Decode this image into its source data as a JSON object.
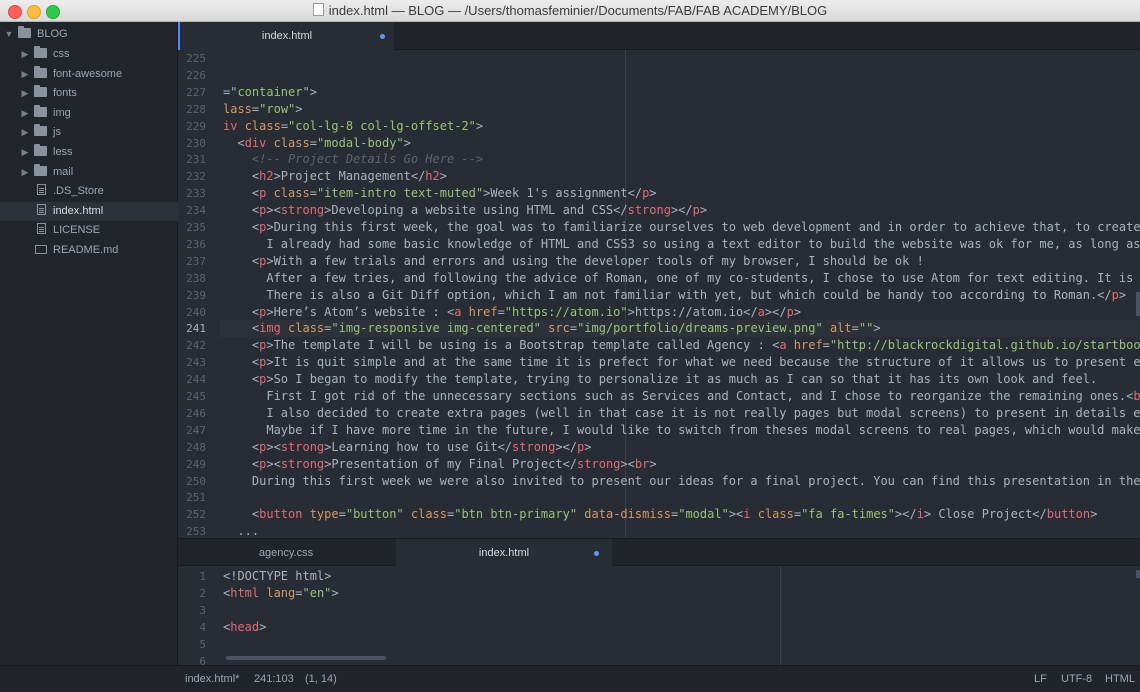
{
  "window": {
    "title": "index.html — BLOG — /Users/thomasfeminier/Documents/FAB/FAB ACADEMY/BLOG"
  },
  "sidebar": {
    "root": "BLOG",
    "items": [
      {
        "label": "css",
        "type": "folder"
      },
      {
        "label": "font-awesome",
        "type": "folder"
      },
      {
        "label": "fonts",
        "type": "folder"
      },
      {
        "label": "img",
        "type": "folder"
      },
      {
        "label": "js",
        "type": "folder"
      },
      {
        "label": "less",
        "type": "folder"
      },
      {
        "label": "mail",
        "type": "folder"
      },
      {
        "label": ".DS_Store",
        "type": "file"
      },
      {
        "label": "index.html",
        "type": "file",
        "selected": true
      },
      {
        "label": "LICENSE",
        "type": "file"
      },
      {
        "label": "README.md",
        "type": "markdown"
      }
    ]
  },
  "top_pane": {
    "tabs": [
      {
        "label": "index.html",
        "active": true,
        "modified": true
      }
    ],
    "current_line": "241",
    "lines": [
      {
        "n": "225",
        "t": [],
        "i": 0
      },
      {
        "n": "226",
        "t": [],
        "i": 0
      },
      {
        "n": "227",
        "t": [
          [
            "txt",
            "=\""
          ],
          [
            "str",
            "container"
          ],
          [
            "txt",
            "\">"
          ]
        ],
        "i": 0
      },
      {
        "n": "228",
        "t": [
          [
            "attr",
            "lass"
          ],
          [
            "txt",
            "="
          ],
          [
            "str",
            "\"row\""
          ],
          [
            "txt",
            ">"
          ]
        ],
        "i": 0
      },
      {
        "n": "229",
        "t": [
          [
            "tag",
            "iv "
          ],
          [
            "attr",
            "class"
          ],
          [
            "txt",
            "="
          ],
          [
            "str",
            "\"col-lg-8 col-lg-offset-2\""
          ],
          [
            "txt",
            ">"
          ]
        ],
        "i": 0
      },
      {
        "n": "230",
        "t": [
          [
            "txt",
            "  <"
          ],
          [
            "tag",
            "div "
          ],
          [
            "attr",
            "class"
          ],
          [
            "txt",
            "="
          ],
          [
            "str",
            "\"modal-body\""
          ],
          [
            "txt",
            ">"
          ]
        ],
        "i": 0
      },
      {
        "n": "231",
        "t": [
          [
            "com",
            "    <!-- Project Details Go Here -->"
          ]
        ],
        "i": 0
      },
      {
        "n": "232",
        "t": [
          [
            "txt",
            "    <"
          ],
          [
            "tag",
            "h2"
          ],
          [
            "txt",
            ">Project Management</"
          ],
          [
            "tag",
            "h2"
          ],
          [
            "txt",
            ">"
          ]
        ],
        "i": 0
      },
      {
        "n": "233",
        "t": [
          [
            "txt",
            "    <"
          ],
          [
            "tag",
            "p "
          ],
          [
            "attr",
            "class"
          ],
          [
            "txt",
            "="
          ],
          [
            "str",
            "\"item-intro text-muted\""
          ],
          [
            "txt",
            ">Week 1's assignment</"
          ],
          [
            "tag",
            "p"
          ],
          [
            "txt",
            ">"
          ]
        ],
        "i": 0
      },
      {
        "n": "234",
        "t": [
          [
            "txt",
            "    <"
          ],
          [
            "tag",
            "p"
          ],
          [
            "txt",
            "><"
          ],
          [
            "tag",
            "strong"
          ],
          [
            "txt",
            ">Developing a website using HTML and CSS</"
          ],
          [
            "tag",
            "strong"
          ],
          [
            "txt",
            "></"
          ],
          [
            "tag",
            "p"
          ],
          [
            "txt",
            ">"
          ]
        ],
        "i": 0
      },
      {
        "n": "235",
        "t": [
          [
            "txt",
            "    <"
          ],
          [
            "tag",
            "p"
          ],
          [
            "txt",
            ">During this first week, the goal was to familiarize ourselves to web development and in order to achieve that, to create our"
          ]
        ],
        "i": 0
      },
      {
        "n": "236",
        "t": [
          [
            "txt",
            "      I already had some basic knowledge of HTML and CSS3 so using a text editor to build the website was ok for me, as long as I"
          ]
        ],
        "i": 0
      },
      {
        "n": "237",
        "t": [
          [
            "txt",
            "    <"
          ],
          [
            "tag",
            "p"
          ],
          [
            "txt",
            ">With a few trials and errors and using the developer tools of my browser, I should be ok !"
          ]
        ],
        "i": 0
      },
      {
        "n": "238",
        "t": [
          [
            "txt",
            "      After a few tries, and following the advice of Roman, one of my co-students, I chose to use Atom for text editing. It is rea"
          ]
        ],
        "i": 0
      },
      {
        "n": "239",
        "t": [
          [
            "txt",
            "      There is also a Git Diff option, which I am not familiar with yet, but which could be handy too according to Roman.</"
          ],
          [
            "tag",
            "p"
          ],
          [
            "txt",
            ">"
          ]
        ],
        "i": 0
      },
      {
        "n": "240",
        "t": [
          [
            "txt",
            "    <"
          ],
          [
            "tag",
            "p"
          ],
          [
            "txt",
            ">Here’s Atom’s website : <"
          ],
          [
            "tag",
            "a "
          ],
          [
            "attr",
            "href"
          ],
          [
            "txt",
            "="
          ],
          [
            "str",
            "\"https://atom.io\""
          ],
          [
            "txt",
            ">https://atom.io</"
          ],
          [
            "tag",
            "a"
          ],
          [
            "txt",
            "></"
          ],
          [
            "tag",
            "p"
          ],
          [
            "txt",
            ">"
          ]
        ],
        "i": 0
      },
      {
        "n": "241",
        "t": [
          [
            "txt",
            "    <"
          ],
          [
            "tag",
            "img "
          ],
          [
            "attr",
            "class"
          ],
          [
            "txt",
            "="
          ],
          [
            "str",
            "\"img-responsive img-centered\""
          ],
          [
            "txt",
            " "
          ],
          [
            "attr",
            "src"
          ],
          [
            "txt",
            "="
          ],
          [
            "str",
            "\"img/portfolio/dreams-preview.png\""
          ],
          [
            "txt",
            " "
          ],
          [
            "attr",
            "alt"
          ],
          [
            "txt",
            "="
          ],
          [
            "str",
            "\"\""
          ],
          [
            "txt",
            ">"
          ]
        ],
        "i": 0
      },
      {
        "n": "242",
        "t": [
          [
            "txt",
            "    <"
          ],
          [
            "tag",
            "p"
          ],
          [
            "txt",
            ">The template I will be using is a Bootstrap template called Agency : <"
          ],
          [
            "tag",
            "a "
          ],
          [
            "attr",
            "href"
          ],
          [
            "txt",
            "="
          ],
          [
            "str",
            "\"http://blackrockdigital.github.io/startbootst"
          ]
        ],
        "i": 0
      },
      {
        "n": "243",
        "t": [
          [
            "txt",
            "    <"
          ],
          [
            "tag",
            "p"
          ],
          [
            "txt",
            ">It is quit simple and at the same time it is prefect for what we need because the structure of it allows us to present each"
          ]
        ],
        "i": 0
      },
      {
        "n": "244",
        "t": [
          [
            "txt",
            "    <"
          ],
          [
            "tag",
            "p"
          ],
          [
            "txt",
            ">So I began to modify the template, trying to personalize it as much as I can so that it has its own look and feel."
          ]
        ],
        "i": 0
      },
      {
        "n": "245",
        "t": [
          [
            "txt",
            "      First I got rid of the unnecessary sections such as Services and Contact, and I chose to reorganize the remaining ones.<"
          ],
          [
            "tag",
            "br"
          ],
          [
            "txt",
            ">"
          ]
        ],
        "i": 0
      },
      {
        "n": "246",
        "t": [
          [
            "txt",
            "      I also decided to create extra pages (well in that case it is not really pages but modal screens) to present in details each"
          ]
        ],
        "i": 0
      },
      {
        "n": "247",
        "t": [
          [
            "txt",
            "      Maybe if I have more time in the future, I would like to switch from theses modal screens to real pages, which would make it"
          ]
        ],
        "i": 0
      },
      {
        "n": "248",
        "t": [
          [
            "txt",
            "    <"
          ],
          [
            "tag",
            "p"
          ],
          [
            "txt",
            "><"
          ],
          [
            "tag",
            "strong"
          ],
          [
            "txt",
            ">Learning how to use Git</"
          ],
          [
            "tag",
            "strong"
          ],
          [
            "txt",
            "></"
          ],
          [
            "tag",
            "p"
          ],
          [
            "txt",
            ">"
          ]
        ],
        "i": 0
      },
      {
        "n": "249",
        "t": [
          [
            "txt",
            "    <"
          ],
          [
            "tag",
            "p"
          ],
          [
            "txt",
            "><"
          ],
          [
            "tag",
            "strong"
          ],
          [
            "txt",
            ">Presentation of my Final Project</"
          ],
          [
            "tag",
            "strong"
          ],
          [
            "txt",
            "><"
          ],
          [
            "tag",
            "br"
          ],
          [
            "txt",
            ">"
          ]
        ],
        "i": 0
      },
      {
        "n": "250",
        "t": [
          [
            "txt",
            "    During this first week we were also invited to present our ideas for a final project. You can find this presentation in the f"
          ]
        ],
        "i": 0
      },
      {
        "n": "251",
        "t": [],
        "i": 0
      },
      {
        "n": "252",
        "t": [
          [
            "txt",
            "    <"
          ],
          [
            "tag",
            "button "
          ],
          [
            "attr",
            "type"
          ],
          [
            "txt",
            "="
          ],
          [
            "str",
            "\"button\""
          ],
          [
            "txt",
            " "
          ],
          [
            "attr",
            "class"
          ],
          [
            "txt",
            "="
          ],
          [
            "str",
            "\"btn btn-primary\""
          ],
          [
            "txt",
            " "
          ],
          [
            "attr",
            "data-dismiss"
          ],
          [
            "txt",
            "="
          ],
          [
            "str",
            "\"modal\""
          ],
          [
            "txt",
            "><"
          ],
          [
            "tag",
            "i "
          ],
          [
            "attr",
            "class"
          ],
          [
            "txt",
            "="
          ],
          [
            "str",
            "\"fa fa-times\""
          ],
          [
            "txt",
            "></"
          ],
          [
            "tag",
            "i"
          ],
          [
            "txt",
            "> Close Project</"
          ],
          [
            "tag",
            "button"
          ],
          [
            "txt",
            ">"
          ]
        ],
        "i": 0
      },
      {
        "n": "253",
        "t": [
          [
            "txt",
            "  ..."
          ]
        ],
        "i": 0
      }
    ]
  },
  "bottom_pane": {
    "tabs": [
      {
        "label": "agency.css",
        "active": false,
        "modified": false
      },
      {
        "label": "index.html",
        "active": true,
        "modified": true
      }
    ],
    "lines": [
      {
        "n": "1",
        "t": [
          [
            "txt",
            "<!DOCTYPE html>"
          ]
        ]
      },
      {
        "n": "2",
        "t": [
          [
            "txt",
            "<"
          ],
          [
            "tag",
            "html "
          ],
          [
            "attr",
            "lang"
          ],
          [
            "txt",
            "="
          ],
          [
            "str",
            "\"en\""
          ],
          [
            "txt",
            ">"
          ]
        ]
      },
      {
        "n": "3",
        "t": []
      },
      {
        "n": "4",
        "t": [
          [
            "txt",
            "<"
          ],
          [
            "tag",
            "head"
          ],
          [
            "txt",
            ">"
          ]
        ]
      },
      {
        "n": "5",
        "t": []
      },
      {
        "n": "6",
        "t": []
      }
    ]
  },
  "statusbar": {
    "file": "index.html*",
    "cursor": "241:103",
    "selection": "(1, 14)",
    "line_ending": "LF",
    "encoding": "UTF-8",
    "grammar": "HTML"
  }
}
